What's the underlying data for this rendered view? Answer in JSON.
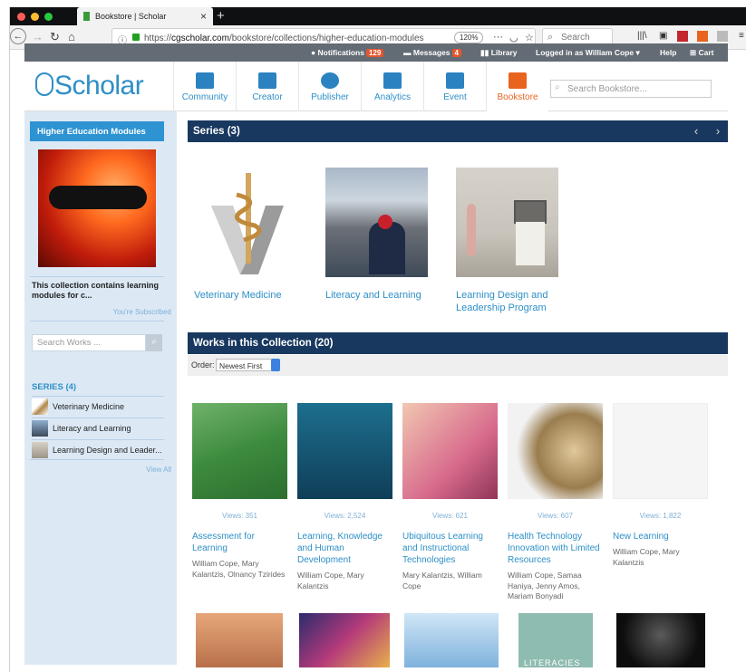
{
  "browser": {
    "tab_title": "Bookstore | Scholar",
    "url_prefix": "https://",
    "url_domain": "cgscholar.com",
    "url_path": "/bookstore/collections/higher-education-modules",
    "zoom": "120%",
    "search_placeholder": "Search"
  },
  "topbar": {
    "notifications_label": "Notifications",
    "notifications_count": "129",
    "messages_label": "Messages",
    "messages_count": "4",
    "library_label": "Library",
    "logged_in": "Logged in as William Cope",
    "help": "Help",
    "cart": "Cart"
  },
  "header": {
    "logo": "Scholar",
    "nav": [
      "Community",
      "Creator",
      "Publisher",
      "Analytics",
      "Event",
      "Bookstore"
    ],
    "active_nav": "Bookstore",
    "search_placeholder": "Search Bookstore..."
  },
  "sidebar": {
    "title": "Higher Education Modules",
    "description": "This collection contains learning modules for c...",
    "subscribed": "You're Subscribed",
    "search_placeholder": "Search Works ...",
    "series_heading": "SERIES (4)",
    "series": [
      "Veterinary Medicine",
      "Literacy and Learning",
      "Learning Design and Leader..."
    ],
    "view_all": "View All"
  },
  "series_section": {
    "heading": "Series (3)",
    "items": [
      {
        "title": "Veterinary Medicine"
      },
      {
        "title": "Literacy and Learning"
      },
      {
        "title": "Learning Design and Leadership Program"
      }
    ]
  },
  "works_section": {
    "heading": "Works in this Collection (20)",
    "order_label": "Order:",
    "order_value": "Newest First",
    "items": [
      {
        "views": "Views: 351",
        "title": "Assessment for Learning",
        "authors": "William Cope, Mary Kalantzis, Olnancy Tzirides"
      },
      {
        "views": "Views: 2,524",
        "title": "Learning, Knowledge and Human Development",
        "authors": "William Cope, Mary Kalantzis"
      },
      {
        "views": "Views: 621",
        "title": "Ubiquitous Learning and Instructional Technologies",
        "authors": "Mary Kalantzis, William Cope"
      },
      {
        "views": "Views: 607",
        "title": "Health Technology Innovation with Limited Resources",
        "authors": "William Cope, Samaa Haniya, Jenny Amos, Mariam Bonyadi"
      },
      {
        "views": "Views: 1,822",
        "title": "New Learning",
        "authors": "William Cope, Mary Kalantzis"
      }
    ],
    "partial_cover_text": "LITERACIES"
  }
}
